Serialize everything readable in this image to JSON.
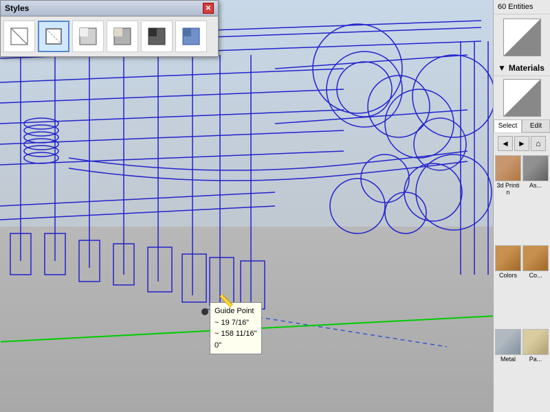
{
  "styles_panel": {
    "title": "Styles",
    "close_label": "✕",
    "icons": [
      {
        "name": "wireframe-style",
        "label": "Wireframe",
        "active": false
      },
      {
        "name": "hidden-line-style",
        "label": "Hidden Line",
        "active": true
      },
      {
        "name": "shaded-style",
        "label": "Shaded",
        "active": false
      },
      {
        "name": "shaded-textured-style",
        "label": "Shaded with Textures",
        "active": false
      },
      {
        "name": "monochrome-style",
        "label": "Monochrome",
        "active": false
      },
      {
        "name": "color-by-layer-style",
        "label": "Color by Layer",
        "active": false
      }
    ]
  },
  "viewport": {
    "guide_tooltip": {
      "line1": "Guide Point",
      "line2": "~ 19 7/16\"",
      "line3": "~ 158 11/16\"",
      "line4": "0\""
    }
  },
  "right_panel": {
    "entities_count": "60 Entities",
    "materials_header": "Materials",
    "tabs": [
      {
        "label": "Select",
        "active": true
      },
      {
        "label": "Edit",
        "active": false
      }
    ],
    "nav": [
      "◄",
      "►",
      "⌂"
    ],
    "material_items": [
      {
        "name": "3d-printing-thumb",
        "label": "3d Printin",
        "class": "mat-thumb-3dprint"
      },
      {
        "name": "asphalt-thumb",
        "label": "As...",
        "class": "mat-thumb-asphalt"
      },
      {
        "name": "colors-thumb",
        "label": "Colors",
        "class": "mat-thumb-colors"
      },
      {
        "name": "colors2-thumb",
        "label": "Co...",
        "class": "mat-thumb-colors2"
      },
      {
        "name": "metal-thumb",
        "label": "Metal",
        "class": "mat-thumb-metal"
      },
      {
        "name": "paper-thumb",
        "label": "Pa...",
        "class": "mat-thumb-paper"
      }
    ]
  }
}
